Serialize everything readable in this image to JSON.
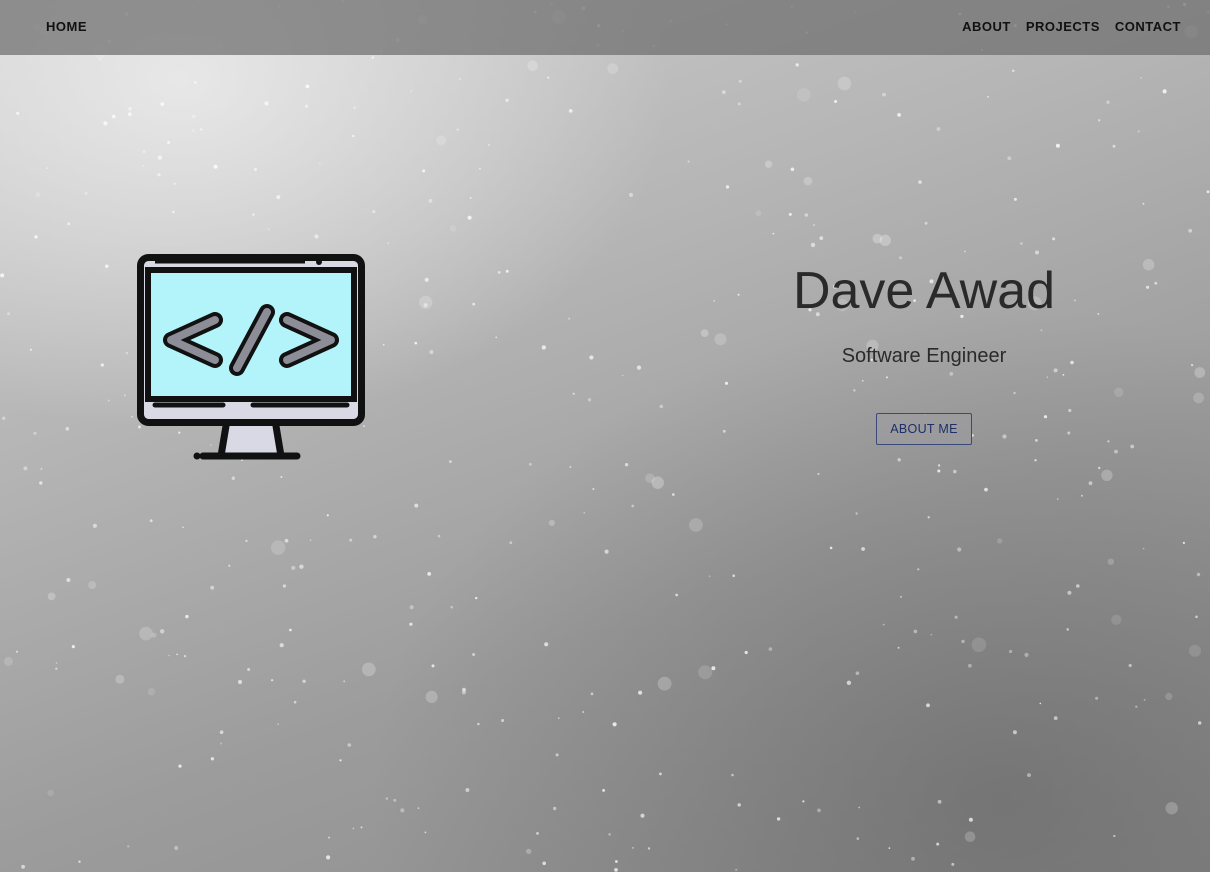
{
  "nav": {
    "home": "HOME",
    "links": [
      "ABOUT",
      "PROJECTS",
      "CONTACT"
    ]
  },
  "hero": {
    "name": "Dave Awad",
    "title": "Software Engineer",
    "button_label": "ABOUT ME",
    "icon": "code-monitor-icon"
  },
  "colors": {
    "navbar": "#6e6e6e",
    "text": "#2a2a2a",
    "button_text": "#1e2f66",
    "screen": "#b3f4fb",
    "stand": "#d9d9e6"
  }
}
